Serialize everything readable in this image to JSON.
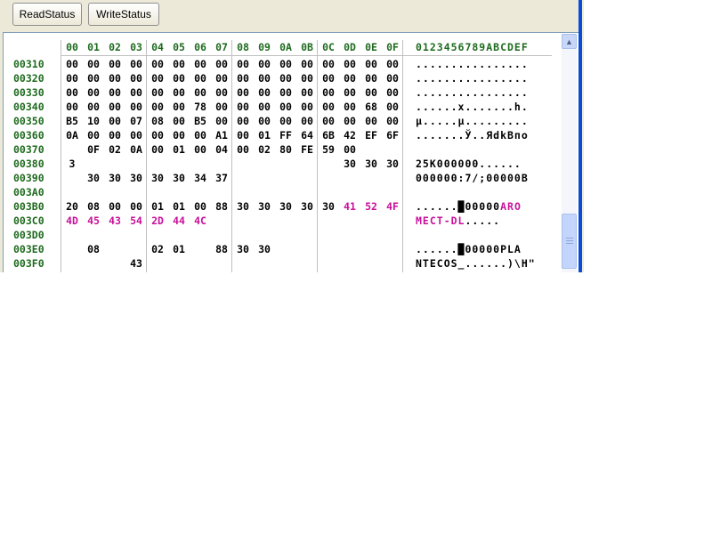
{
  "toolbar": {
    "read_label": "ReadStatus",
    "write_label": "WriteStatus"
  },
  "scrollbar": {
    "up_icon": "arrow-up-icon"
  },
  "hex_header": {
    "columns": [
      "00",
      "01",
      "02",
      "03",
      "04",
      "05",
      "06",
      "07",
      "08",
      "09",
      "0A",
      "0B",
      "0C",
      "0D",
      "0E",
      "0F"
    ],
    "ascii": "0123456789ABCDEF"
  },
  "hex_rows": [
    {
      "addr": "00310",
      "bytes": [
        "00",
        "00",
        "00",
        "00",
        "00",
        "00",
        "00",
        "00",
        "00",
        "00",
        "00",
        "00",
        "00",
        "00",
        "00",
        "00"
      ],
      "ascii": "................"
    },
    {
      "addr": "00320",
      "bytes": [
        "00",
        "00",
        "00",
        "00",
        "00",
        "00",
        "00",
        "00",
        "00",
        "00",
        "00",
        "00",
        "00",
        "00",
        "00",
        "00"
      ],
      "ascii": "................"
    },
    {
      "addr": "00330",
      "bytes": [
        "00",
        "00",
        "00",
        "00",
        "00",
        "00",
        "00",
        "00",
        "00",
        "00",
        "00",
        "00",
        "00",
        "00",
        "00",
        "00"
      ],
      "ascii": "................"
    },
    {
      "addr": "00340",
      "bytes": [
        "00",
        "00",
        "00",
        "00",
        "00",
        "00",
        "78",
        "00",
        "00",
        "00",
        "00",
        "00",
        "00",
        "00",
        "68",
        "00"
      ],
      "ascii": "......x.......h."
    },
    {
      "addr": "00350",
      "bytes": [
        "B5",
        "10",
        "00",
        "07",
        "08",
        "00",
        "B5",
        "00",
        "00",
        "00",
        "00",
        "00",
        "00",
        "00",
        "00",
        "00"
      ],
      "ascii": "µ.....µ........."
    },
    {
      "addr": "00360",
      "bytes": [
        "0A",
        "00",
        "00",
        "00",
        "00",
        "00",
        "00",
        "A1",
        "00",
        "01",
        "FF",
        "64",
        "6B",
        "42",
        "EF",
        "6F"
      ],
      "ascii": ".......Ў..ЯdkBпо"
    },
    {
      "addr": "00370",
      "bytes": [
        "",
        "0F",
        "02",
        "0A",
        "00",
        "01",
        "00",
        "04",
        "00",
        "02",
        "80",
        "FE",
        "59",
        "00",
        "",
        ""
      ],
      "ascii": ""
    },
    {
      "addr": "00380",
      "bytes": [
        "3",
        "",
        "",
        "",
        "",
        "",
        "",
        "",
        "",
        "",
        "",
        "",
        "",
        "30",
        "30",
        "30"
      ],
      "ascii": "25K000000......"
    },
    {
      "addr": "00390",
      "bytes": [
        "",
        "30",
        "30",
        "30",
        "30",
        "30",
        "34",
        "37",
        "",
        "",
        "",
        "",
        "",
        "",
        "",
        ""
      ],
      "ascii": "000000:7/;00000B"
    },
    {
      "addr": "003A0",
      "bytes": [
        "",
        "",
        "",
        "",
        "",
        "",
        "",
        "",
        "",
        "",
        "",
        "",
        "",
        "",
        "",
        ""
      ],
      "ascii": ""
    },
    {
      "addr": "003B0",
      "bytes": [
        "20",
        "08",
        "00",
        "00",
        "01",
        "01",
        "00",
        "88",
        "30",
        "30",
        "30",
        "30",
        "30",
        "41",
        "52",
        "4F"
      ],
      "ascii": "......█00000ARO",
      "pink_from": 13,
      "ascii_pink_from": 12
    },
    {
      "addr": "003C0",
      "bytes": [
        "4D",
        "45",
        "43",
        "54",
        "2D",
        "44",
        "4C",
        "",
        "",
        "",
        "",
        "",
        "",
        "",
        "",
        ""
      ],
      "ascii": "MECT-DL.....",
      "pink_from": 0,
      "pink_to": 6,
      "ascii_pink_to": 6
    },
    {
      "addr": "003D0",
      "bytes": [
        "",
        "",
        "",
        "",
        "",
        "",
        "",
        "",
        "",
        "",
        "",
        "",
        "",
        "",
        "",
        ""
      ],
      "ascii": ""
    },
    {
      "addr": "003E0",
      "bytes": [
        "",
        "08",
        "",
        "",
        "02",
        "01",
        "",
        "88",
        "30",
        "30",
        "",
        "",
        "",
        "",
        "",
        ""
      ],
      "ascii": "......█00000PLA"
    },
    {
      "addr": "003F0",
      "bytes": [
        "",
        "",
        "",
        "43",
        "",
        "",
        "",
        "",
        "",
        "",
        "",
        "",
        "",
        "",
        "",
        ""
      ],
      "ascii": "NTECOS_......)\\H\""
    }
  ]
}
